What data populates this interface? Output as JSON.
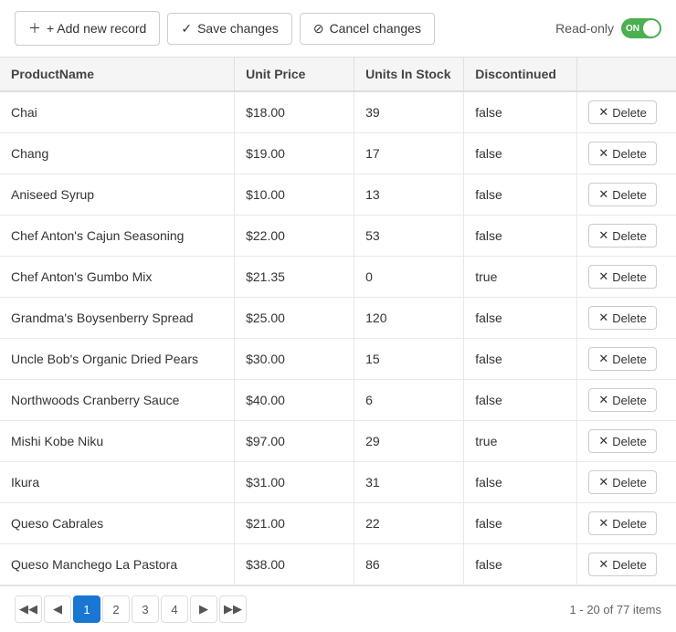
{
  "toolbar": {
    "add_label": "+ Add new record",
    "save_label": "Save changes",
    "cancel_label": "Cancel changes",
    "readonly_label": "Read-only",
    "toggle_state": "ON"
  },
  "table": {
    "columns": [
      "ProductName",
      "Unit Price",
      "Units In Stock",
      "Discontinued"
    ],
    "delete_label": "Delete",
    "rows": [
      {
        "name": "Chai",
        "price": "$18.00",
        "stock": "39",
        "discontinued": "false"
      },
      {
        "name": "Chang",
        "price": "$19.00",
        "stock": "17",
        "discontinued": "false"
      },
      {
        "name": "Aniseed Syrup",
        "price": "$10.00",
        "stock": "13",
        "discontinued": "false"
      },
      {
        "name": "Chef Anton's Cajun Seasoning",
        "price": "$22.00",
        "stock": "53",
        "discontinued": "false"
      },
      {
        "name": "Chef Anton's Gumbo Mix",
        "price": "$21.35",
        "stock": "0",
        "discontinued": "true"
      },
      {
        "name": "Grandma's Boysenberry Spread",
        "price": "$25.00",
        "stock": "120",
        "discontinued": "false"
      },
      {
        "name": "Uncle Bob's Organic Dried Pears",
        "price": "$30.00",
        "stock": "15",
        "discontinued": "false"
      },
      {
        "name": "Northwoods Cranberry Sauce",
        "price": "$40.00",
        "stock": "6",
        "discontinued": "false"
      },
      {
        "name": "Mishi Kobe Niku",
        "price": "$97.00",
        "stock": "29",
        "discontinued": "true"
      },
      {
        "name": "Ikura",
        "price": "$31.00",
        "stock": "31",
        "discontinued": "false"
      },
      {
        "name": "Queso Cabrales",
        "price": "$21.00",
        "stock": "22",
        "discontinued": "false"
      },
      {
        "name": "Queso Manchego La Pastora",
        "price": "$38.00",
        "stock": "86",
        "discontinued": "false"
      }
    ]
  },
  "pagination": {
    "pages": [
      "1",
      "2",
      "3",
      "4"
    ],
    "active_page": "1",
    "summary": "1 - 20 of 77 items"
  }
}
